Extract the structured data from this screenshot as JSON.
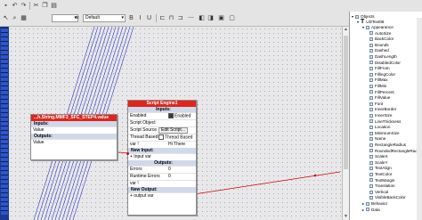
{
  "toolbar": {
    "zoom_combo": "",
    "style_combo": "Default"
  },
  "node_string": {
    "title": "...h.String.MMF3_SFC_STEP4.value",
    "inputs_label": "Inputs:",
    "input_row": "Value",
    "outputs_label": "Outputs:",
    "output_row": "Value"
  },
  "node_script": {
    "title": "Script Engine1",
    "inputs_label": "Inputs:",
    "enabled_label": "Enabled",
    "enabled_value": "Enabled",
    "script_object_label": "Script Object",
    "script_source_label": "Script Source",
    "script_source_button": "Edit Script...",
    "thread_based_label": "Thread Based",
    "thread_based_value": "Thread Based",
    "var1_label": "var !",
    "var1_value": "Hi There",
    "new_input_label": "New Input:",
    "new_input_value": "+ Input var",
    "outputs_label": "Outputs:",
    "errors_label": "Errors",
    "errors_value": "0",
    "runtime_errors_label": "Runtime Errors",
    "runtime_errors_value": "0",
    "var_out_label": "var !",
    "new_output_label": "New Output:",
    "new_output_value": "+ output var"
  },
  "panel": {
    "root": "Objects",
    "object": "UDText08",
    "items": [
      "Appearance",
      "AutoSize",
      "BackColor",
      "Bounds",
      "Dashed",
      "DashLength",
      "DisabledColor",
      "FillFrom",
      "FillingColor",
      "FillMax",
      "FillMin",
      "FillPercent",
      "FillValue",
      "Font",
      "InnerBorder",
      "InnerSize",
      "LineThickness",
      "Location",
      "MinimumSize",
      "Name",
      "RectangleRadius",
      "RoundedRectangleRadius",
      "ScaleX",
      "ScaleY",
      "TextAlign",
      "TextColor",
      "TextMargin",
      "Translation",
      "Vertical",
      "VisibleBackColor",
      "Behavior",
      "Data"
    ]
  }
}
